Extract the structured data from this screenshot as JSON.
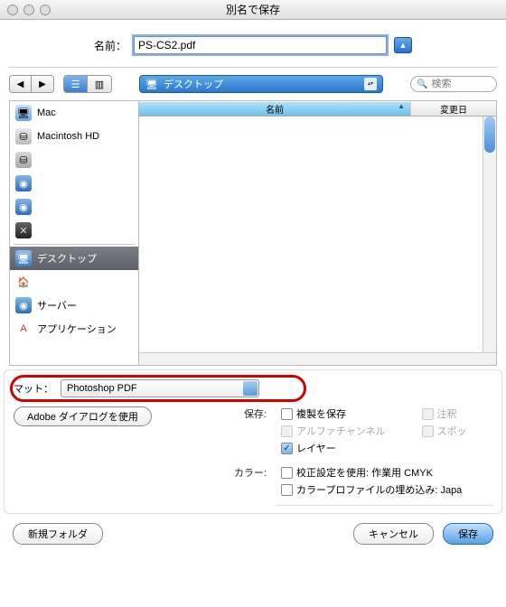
{
  "window": {
    "title": "別名で保存"
  },
  "name": {
    "label": "名前：",
    "value": "PS-CS2.pdf"
  },
  "location": {
    "selected": "デスクトップ"
  },
  "search": {
    "placeholder": "検索"
  },
  "sidebar": {
    "items": [
      {
        "label": "Mac"
      },
      {
        "label": "Macintosh HD"
      },
      {
        "label": ""
      },
      {
        "label": ""
      },
      {
        "label": ""
      },
      {
        "label": ""
      },
      {
        "label": "デスクトップ"
      },
      {
        "label": ""
      },
      {
        "label": "サーバー"
      },
      {
        "label": "アプリケーション"
      }
    ]
  },
  "columns": {
    "name": "名前",
    "modified": "変更日"
  },
  "format": {
    "label": "マット：",
    "selected": "Photoshop PDF"
  },
  "adobe_dialog": "Adobe ダイアログを使用",
  "save_section": {
    "label": "保存:",
    "duplicate": "複製を保存",
    "annotations": "注釈",
    "alpha": "アルファチャンネル",
    "spot": "スポッ",
    "layers": "レイヤー"
  },
  "color_section": {
    "label": "カラー:",
    "proof": "校正設定を使用: 作業用 CMYK",
    "embed": "カラープロファイルの埋め込み: Japa"
  },
  "footer": {
    "new_folder": "新規フォルダ",
    "cancel": "キャンセル",
    "save": "保存"
  }
}
